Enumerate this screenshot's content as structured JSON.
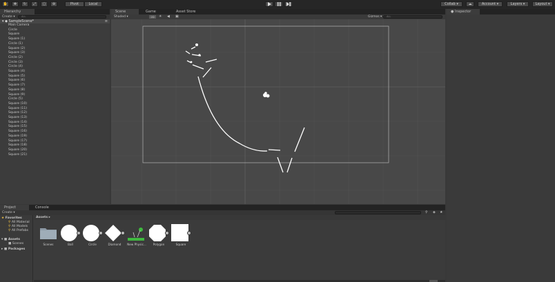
{
  "toolbar": {
    "pivot": "Pivot",
    "local": "Local",
    "collab": "Collab",
    "account": "Account",
    "layers": "Layers",
    "layout": "Layout"
  },
  "hierarchy": {
    "tab": "Hierarchy",
    "create": "Create",
    "search_placeholder": "ALL",
    "scene": "SampleScene*",
    "items": [
      "Main Camera",
      "Circle",
      "Square",
      "Square (1)",
      "Circle (1)",
      "Square (2)",
      "Square (3)",
      "Circle (2)",
      "Circle (3)",
      "Circle (4)",
      "Square (4)",
      "Square (5)",
      "Square (6)",
      "Square (7)",
      "Square (8)",
      "Square (9)",
      "Circle (5)",
      "Square (10)",
      "Square (11)",
      "Square (12)",
      "Square (13)",
      "Square (14)",
      "Square (15)",
      "Square (16)",
      "Square (19)",
      "Square (17)",
      "Square (18)",
      "Square (20)",
      "Square (21)"
    ]
  },
  "scene": {
    "tabs": [
      "Scene",
      "Game",
      "Asset Store"
    ],
    "shading": "Shaded",
    "mode_2d": "2D",
    "gizmos": "Gizmos",
    "search_placeholder": "ALL"
  },
  "inspector": {
    "tab": "Inspector"
  },
  "project": {
    "tabs": [
      "Project",
      "Console"
    ],
    "create": "Create",
    "favorites": "Favorites",
    "favorite_items": [
      "All Material",
      "All Models",
      "All Prefabs"
    ],
    "assets_folder": "Assets",
    "asset_subfolders": [
      "Scenes"
    ],
    "packages": "Packages",
    "breadcrumb": "Assets",
    "assets": [
      "Scenes",
      "Ball",
      "Circle",
      "Diamond",
      "New Physic...",
      "Polygon",
      "Square"
    ]
  }
}
